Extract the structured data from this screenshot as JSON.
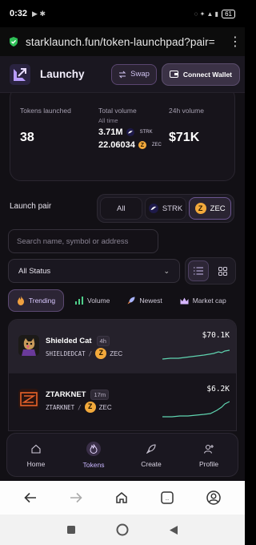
{
  "status_bar": {
    "time": "0:32",
    "left_icons": "▶ ✱",
    "right_icons": "◌ ✦ ▲ ▮",
    "battery": "61"
  },
  "browser": {
    "url": "starklaunch.fun/token-launchpad?pair="
  },
  "header": {
    "brand": "Launchy",
    "swap_label": "Swap",
    "wallet_label": "Connect Wallet"
  },
  "stats": {
    "tokens_label": "Tokens launched",
    "tokens_value": "38",
    "volume_label": "Total volume",
    "volume_sub": "All time",
    "volume_strk": "3.71M",
    "strk_label": "STRK",
    "volume_zec": "22.06034",
    "zec_label": "ZEC",
    "h24_label": "24h volume",
    "h24_value": "$71K"
  },
  "launch_pair": {
    "label": "Launch pair",
    "options": [
      "All",
      "STRK",
      "ZEC"
    ],
    "selected": "ZEC"
  },
  "search": {
    "placeholder": "Search name, symbol or address"
  },
  "status_filter": {
    "value": "All Status"
  },
  "sort_tabs": [
    "Trending",
    "Volume",
    "Newest",
    "Market cap"
  ],
  "tokens": [
    {
      "name": "Shielded Cat",
      "age": "4h",
      "symbol": "SHIELDEDCAT",
      "pair": "ZEC",
      "value": "$70.1K"
    },
    {
      "name": "ZTARKNET",
      "age": "17m",
      "symbol": "ZTARKNET",
      "pair": "ZEC",
      "value": "$6.2K"
    }
  ],
  "bottom_nav": [
    "Home",
    "Tokens",
    "Create",
    "Profile"
  ],
  "colors": {
    "accent": "#8b6cf0",
    "spark": "#5fd4b0",
    "zec": "#f2a93b"
  }
}
